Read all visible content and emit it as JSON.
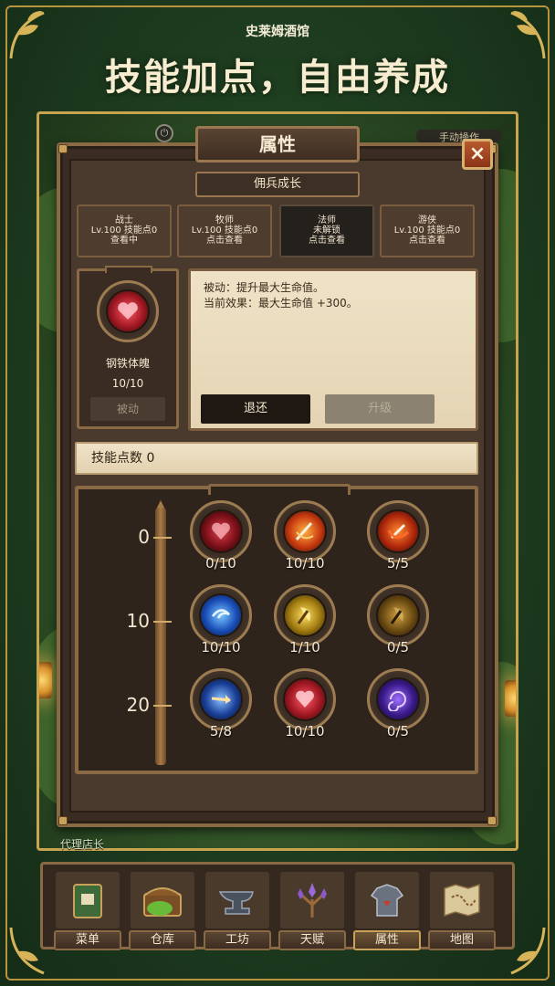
{
  "header": {
    "subtitle": "史莱姆酒馆",
    "headline": "技能加点，自由养成"
  },
  "scene": {
    "manual_hint": "手动操作",
    "agent_label": "代理店长"
  },
  "panel": {
    "title": "属性",
    "close_label": "×",
    "section_button": "佣兵成长"
  },
  "class_tabs": [
    {
      "name": "战士",
      "info": "Lv.100 技能点0",
      "status": "查看中",
      "active": false
    },
    {
      "name": "牧师",
      "info": "Lv.100 技能点0",
      "status": "点击查看",
      "active": false
    },
    {
      "name": "法师",
      "info": "未解锁",
      "status": "点击查看",
      "active": true
    },
    {
      "name": "游侠",
      "info": "Lv.100 技能点0",
      "status": "点击查看",
      "active": false
    }
  ],
  "selected_skill": {
    "name": "钢铁体魄",
    "level": "10/10",
    "type": "被动",
    "description_line1": "被动：提升最大生命值。",
    "description_line2": "当前效果：最大生命值 +300。",
    "return_label": "退还",
    "upgrade_label": "升级"
  },
  "skill_points": {
    "label": "技能点数 0"
  },
  "tree": {
    "tiers": [
      "0",
      "10",
      "20"
    ],
    "nodes": [
      {
        "count": "0/10",
        "icon": "heart-armor-icon",
        "color": "#b0202a"
      },
      {
        "count": "10/10",
        "icon": "sword-slash-icon",
        "color": "#d8581a"
      },
      {
        "count": "5/5",
        "icon": "blade-fire-icon",
        "color": "#c8401a"
      },
      {
        "count": "10/10",
        "icon": "wind-swirl-icon",
        "color": "#2a64c8"
      },
      {
        "count": "1/10",
        "icon": "golden-axe-icon",
        "color": "#c8a020"
      },
      {
        "count": "0/5",
        "icon": "dark-axe-icon",
        "color": "#7a5a20"
      },
      {
        "count": "5/8",
        "icon": "spear-strike-icon",
        "color": "#2a5ab8"
      },
      {
        "count": "10/10",
        "icon": "crimson-heart-icon",
        "color": "#b82a2a"
      },
      {
        "count": "0/5",
        "icon": "void-vortex-icon",
        "color": "#4a2a9a"
      }
    ]
  },
  "nav": [
    {
      "label": "菜单",
      "icon": "book-menu-icon"
    },
    {
      "label": "仓库",
      "icon": "treasure-chest-icon"
    },
    {
      "label": "工坊",
      "icon": "anvil-icon"
    },
    {
      "label": "天赋",
      "icon": "crystal-tree-icon"
    },
    {
      "label": "属性",
      "icon": "armor-icon"
    },
    {
      "label": "地图",
      "icon": "map-icon"
    }
  ]
}
